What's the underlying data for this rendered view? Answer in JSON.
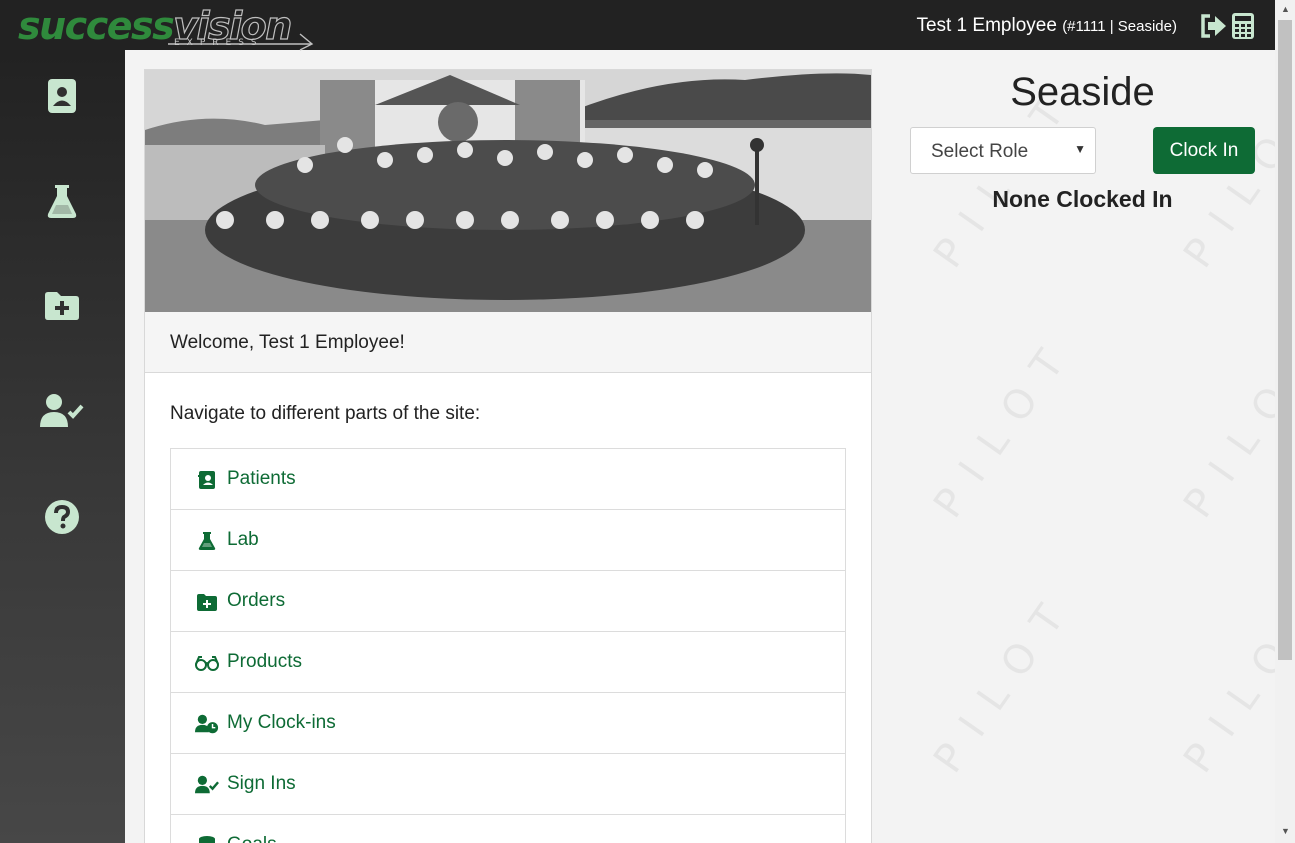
{
  "app": {
    "logo": {
      "part1": "success",
      "part2": "vision",
      "sub": "EXPRESS"
    },
    "user": {
      "name": "Test 1 Employee",
      "meta": "(#1111 | Seaside)"
    }
  },
  "sidebar": {
    "items": [
      {
        "name": "patients",
        "icon": "address-book-icon"
      },
      {
        "name": "lab",
        "icon": "flask-icon"
      },
      {
        "name": "orders",
        "icon": "folder-plus-icon"
      },
      {
        "name": "sign-ins",
        "icon": "user-check-icon"
      },
      {
        "name": "help",
        "icon": "question-circle-icon"
      }
    ]
  },
  "main": {
    "welcome": "Welcome, Test 1 Employee!",
    "nav_caption": "Navigate to different parts of the site:",
    "nav_items": [
      {
        "label": "Patients",
        "icon": "address-book-icon"
      },
      {
        "label": "Lab",
        "icon": "flask-icon"
      },
      {
        "label": "Orders",
        "icon": "folder-plus-icon"
      },
      {
        "label": "Products",
        "icon": "glasses-icon"
      },
      {
        "label": "My Clock-ins",
        "icon": "user-clock-icon"
      },
      {
        "label": "Sign Ins",
        "icon": "user-check-icon"
      },
      {
        "label": "Goals",
        "icon": "database-icon"
      }
    ]
  },
  "panel": {
    "store": "Seaside",
    "role_select": {
      "value": "Select Role"
    },
    "clock_in_label": "Clock In",
    "status": "None Clocked In",
    "watermark": "PILOT"
  },
  "colors": {
    "accent": "#0e6b35",
    "sidebar_icon": "#c8e6cf",
    "topbar": "#222222"
  }
}
